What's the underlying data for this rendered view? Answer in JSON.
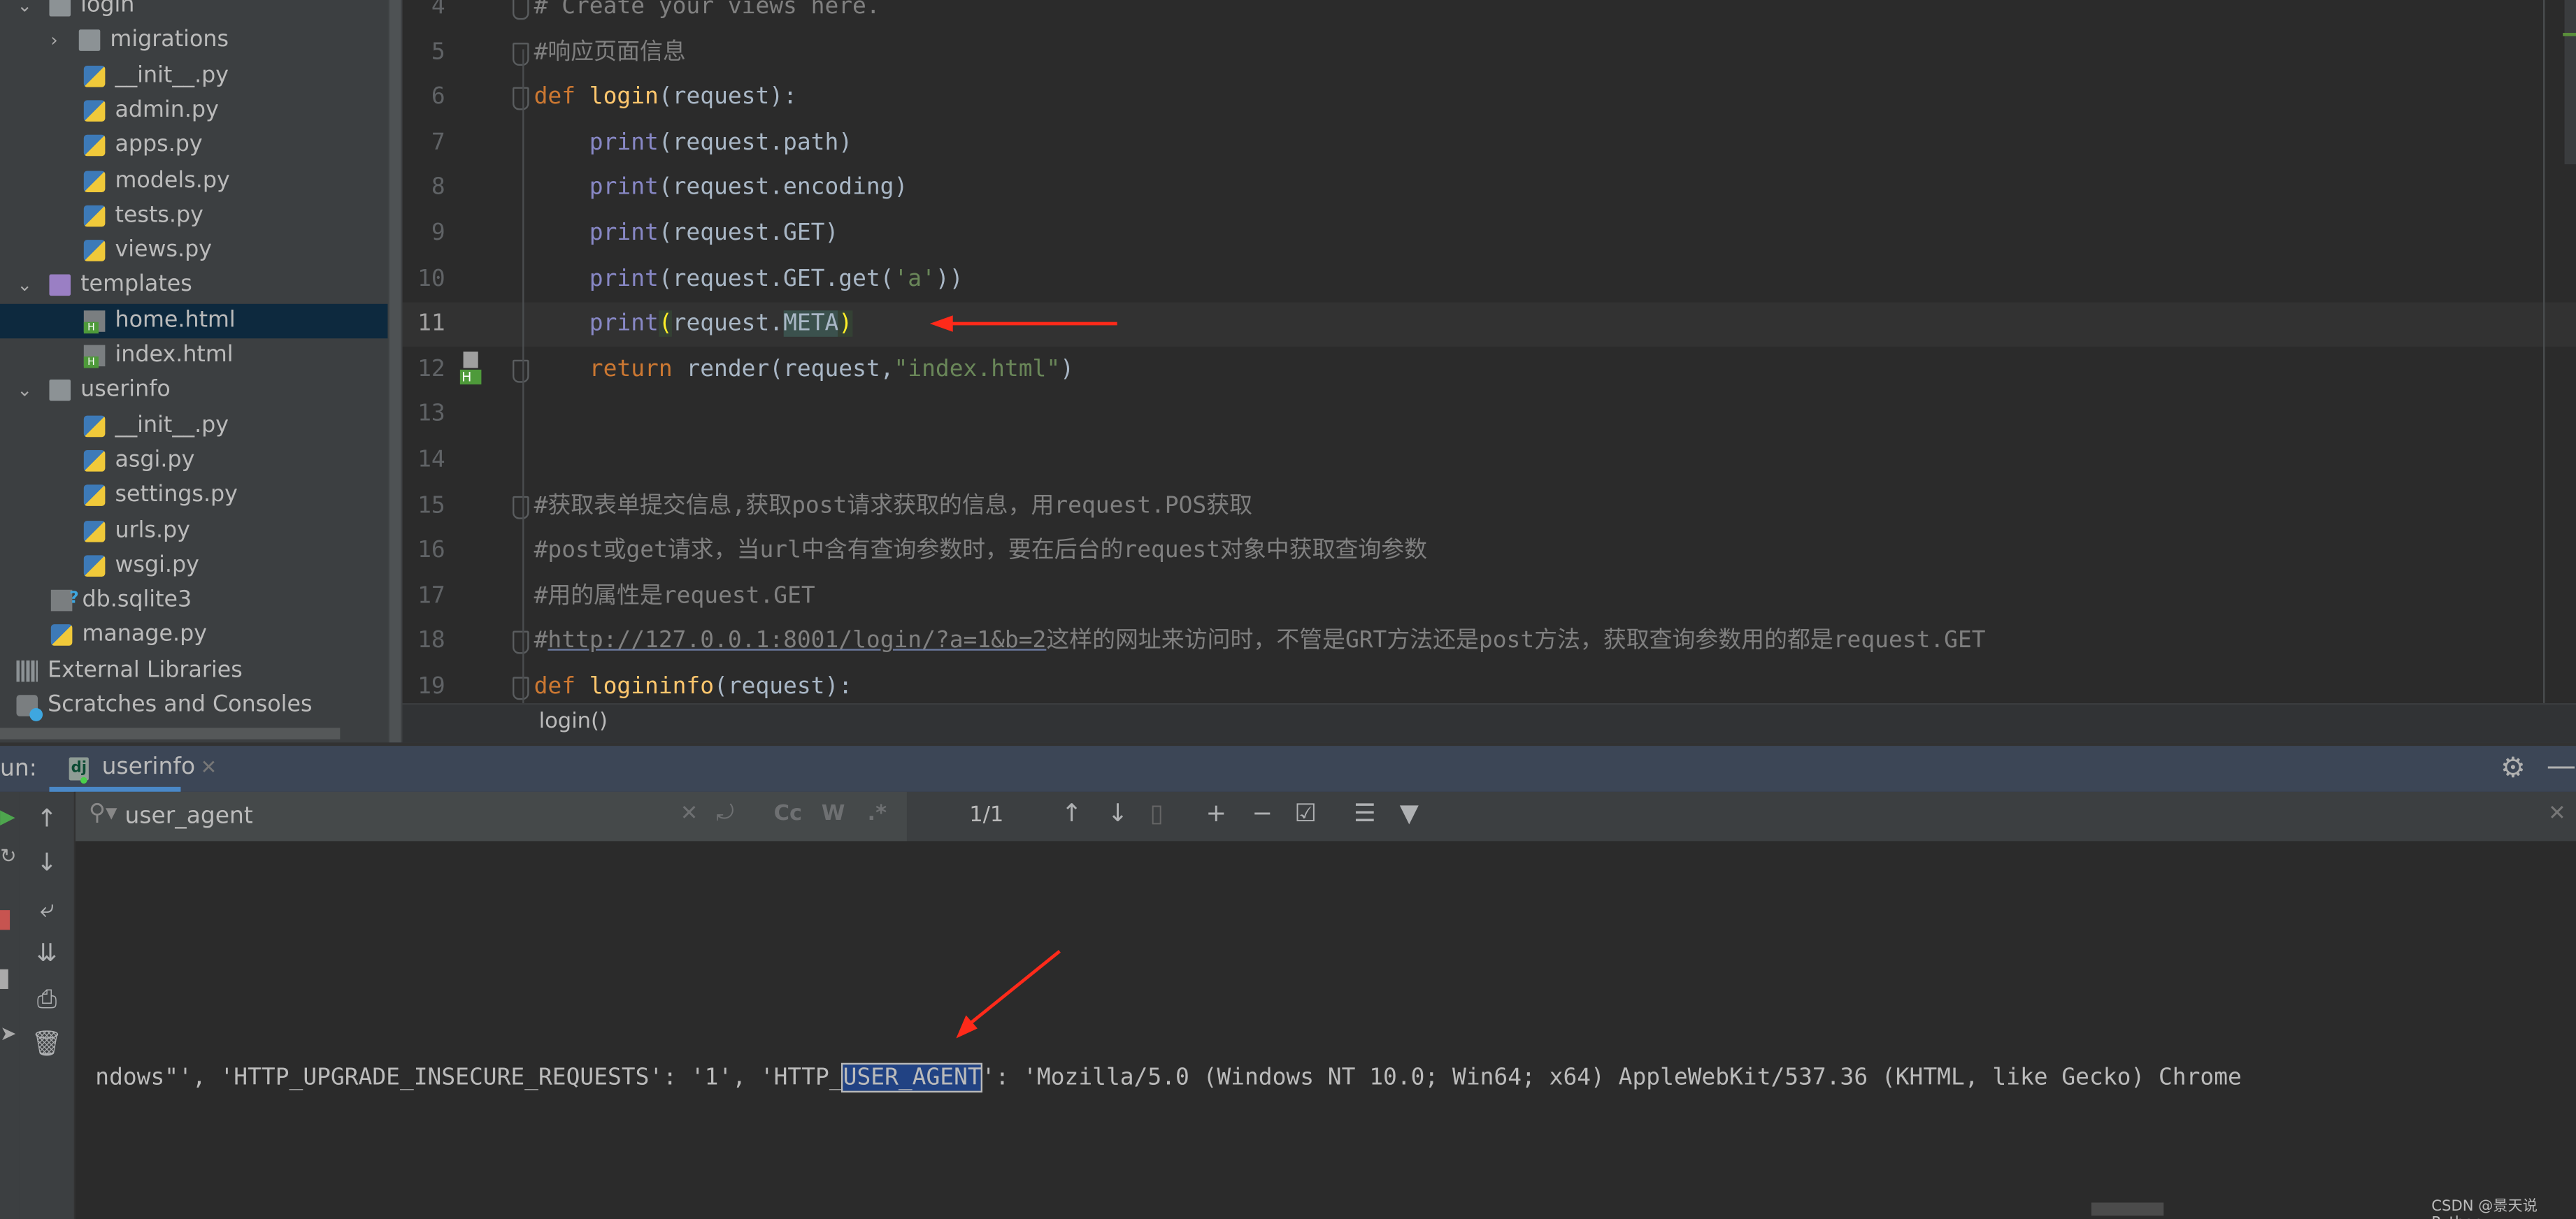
{
  "project_tree": [
    {
      "label": "login",
      "type": "folder",
      "depth": 0,
      "expanded": true
    },
    {
      "label": "migrations",
      "type": "folder",
      "depth": 1,
      "expanded": false
    },
    {
      "label": "__init__.py",
      "type": "py",
      "depth": 2
    },
    {
      "label": "admin.py",
      "type": "py",
      "depth": 2
    },
    {
      "label": "apps.py",
      "type": "py",
      "depth": 2
    },
    {
      "label": "models.py",
      "type": "py",
      "depth": 2
    },
    {
      "label": "tests.py",
      "type": "py",
      "depth": 2
    },
    {
      "label": "views.py",
      "type": "py",
      "depth": 2
    },
    {
      "label": "templates",
      "type": "folder-tpl",
      "depth": 0,
      "expanded": true
    },
    {
      "label": "home.html",
      "type": "html",
      "depth": 2,
      "selected": true
    },
    {
      "label": "index.html",
      "type": "html",
      "depth": 2
    },
    {
      "label": "userinfo",
      "type": "folder",
      "depth": 0,
      "expanded": true
    },
    {
      "label": "__init__.py",
      "type": "py",
      "depth": 2
    },
    {
      "label": "asgi.py",
      "type": "py",
      "depth": 2
    },
    {
      "label": "settings.py",
      "type": "py",
      "depth": 2
    },
    {
      "label": "urls.py",
      "type": "py",
      "depth": 2
    },
    {
      "label": "wsgi.py",
      "type": "py",
      "depth": 2
    },
    {
      "label": "db.sqlite3",
      "type": "db",
      "depth": 1
    },
    {
      "label": "manage.py",
      "type": "py",
      "depth": 1
    },
    {
      "label": "External Libraries",
      "type": "lib",
      "depth": -1
    },
    {
      "label": "Scratches and Consoles",
      "type": "scratch",
      "depth": -1
    }
  ],
  "editor": {
    "current_line": 11,
    "lines": [
      {
        "n": "4",
        "fold": true,
        "tokens": [
          {
            "t": "# Create your views here.",
            "c": "c"
          }
        ]
      },
      {
        "n": "5",
        "fold": true,
        "tokens": [
          {
            "t": "#响应页面信息",
            "c": "c"
          }
        ]
      },
      {
        "n": "6",
        "fold": true,
        "tokens": [
          {
            "t": "def ",
            "c": "k"
          },
          {
            "t": "login",
            "c": "f"
          },
          {
            "t": "(request):",
            "c": "t"
          }
        ]
      },
      {
        "n": "7",
        "tokens": [
          {
            "t": "    print",
            "c": "b"
          },
          {
            "t": "(request.path)",
            "c": "t"
          }
        ]
      },
      {
        "n": "8",
        "tokens": [
          {
            "t": "    print",
            "c": "b"
          },
          {
            "t": "(request.encoding)",
            "c": "t"
          }
        ]
      },
      {
        "n": "9",
        "tokens": [
          {
            "t": "    print",
            "c": "b"
          },
          {
            "t": "(request.GET)",
            "c": "t"
          }
        ]
      },
      {
        "n": "10",
        "tokens": [
          {
            "t": "    print",
            "c": "b"
          },
          {
            "t": "(request.GET.get(",
            "c": "t"
          },
          {
            "t": "'a'",
            "c": "s"
          },
          {
            "t": "))",
            "c": "t"
          }
        ]
      },
      {
        "n": "11",
        "tokens": [
          {
            "t": "    print",
            "c": "b"
          },
          {
            "t": "(",
            "c": "hl2"
          },
          {
            "t": "request.",
            "c": "t"
          },
          {
            "t": "META",
            "c": "t hl"
          },
          {
            "t": ")",
            "c": "hl2"
          }
        ]
      },
      {
        "n": "12",
        "fold": true,
        "tokens": [
          {
            "t": "    return ",
            "c": "k"
          },
          {
            "t": "render(request,",
            "c": "t"
          },
          {
            "t": "\"index.html\"",
            "c": "s"
          },
          {
            "t": ")",
            "c": "t"
          }
        ]
      },
      {
        "n": "13",
        "tokens": []
      },
      {
        "n": "14",
        "tokens": []
      },
      {
        "n": "15",
        "fold": true,
        "tokens": [
          {
            "t": "#获取表单提交信息,获取post请求获取的信息，用request.POS获取",
            "c": "c"
          }
        ]
      },
      {
        "n": "16",
        "tokens": [
          {
            "t": "#post或get请求，当url中含有查询参数时，要在后台的request对象中获取查询参数",
            "c": "c"
          }
        ]
      },
      {
        "n": "17",
        "tokens": [
          {
            "t": "#用的属性是request.GET",
            "c": "c"
          }
        ]
      },
      {
        "n": "18",
        "fold": true,
        "tokens": [
          {
            "t": "#",
            "c": "c"
          },
          {
            "t": "http://127.0.0.1:8001/login/?a=1&b=2",
            "c": "u"
          },
          {
            "t": "这样的网址来访问时，不管是GRT方法还是post方法，获取查询参数用的都是request.GET",
            "c": "c"
          }
        ]
      },
      {
        "n": "19",
        "fold": true,
        "tokens": [
          {
            "t": "def ",
            "c": "k"
          },
          {
            "t": "logininfo",
            "c": "f"
          },
          {
            "t": "(request):",
            "c": "t"
          }
        ]
      }
    ]
  },
  "breadcrumb": "login()",
  "run_panel": {
    "label": "un:",
    "tab": "userinfo",
    "tab_icon": "dj",
    "search": {
      "value": "user_agent",
      "case_label": "Cc",
      "words_label": "W",
      "regex_label": ".*"
    },
    "match_count": "1/1",
    "console_before": "ndows\"', 'HTTP_UPGRADE_INSECURE_REQUESTS': '1', 'HTTP_",
    "console_match": "USER_AGENT",
    "console_after": "': 'Mozilla/5.0 (Windows NT 10.0; Win64; x64) AppleWebKit/537.36 (KHTML, like Gecko) Chrome"
  },
  "watermark": "CSDN @景天说Python",
  "colors": {
    "annotation_arrow": "#ff2a1a",
    "selection": "#214283",
    "keyword": "#cc7832",
    "function": "#ffc66d",
    "builtin": "#8888c6",
    "string": "#6a8759",
    "comment": "#808080"
  }
}
